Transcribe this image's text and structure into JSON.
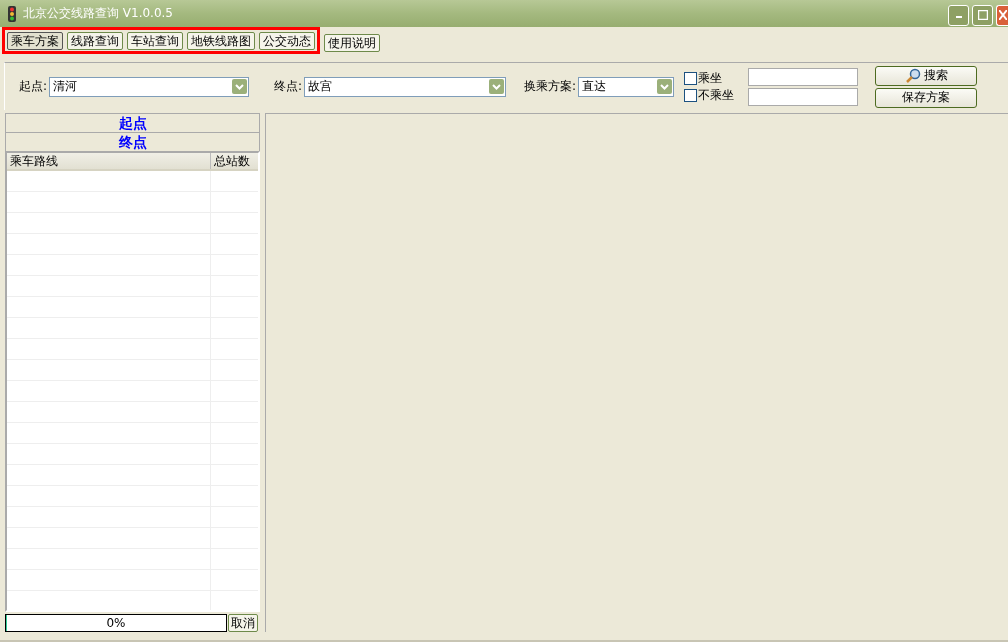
{
  "window": {
    "title": "北京公交线路查询 V1.0.0.5"
  },
  "tabs": [
    {
      "label": "乘车方案",
      "selected": true,
      "highlighted": true
    },
    {
      "label": "线路查询",
      "selected": false,
      "highlighted": true
    },
    {
      "label": "车站查询",
      "selected": false,
      "highlighted": true
    },
    {
      "label": "地铁线路图",
      "selected": false,
      "highlighted": true
    },
    {
      "label": "公交动态",
      "selected": false,
      "highlighted": true
    },
    {
      "label": "使用说明",
      "selected": false,
      "highlighted": false
    }
  ],
  "query": {
    "start_label": "起点:",
    "start_value": "清河",
    "end_label": "终点:",
    "end_value": "故宫",
    "transfer_label": "换乘方案:",
    "transfer_value": "直达",
    "options": [
      {
        "label": "乘坐",
        "checked": false
      },
      {
        "label": "不乘坐",
        "checked": false
      }
    ],
    "search_button": "搜索",
    "save_button": "保存方案"
  },
  "summary": {
    "start": "起点",
    "end": "终点"
  },
  "table": {
    "columns": [
      "乘车路线",
      "总站数"
    ]
  },
  "progress": {
    "level": 0,
    "reading": "0%",
    "cancel": "取消"
  }
}
